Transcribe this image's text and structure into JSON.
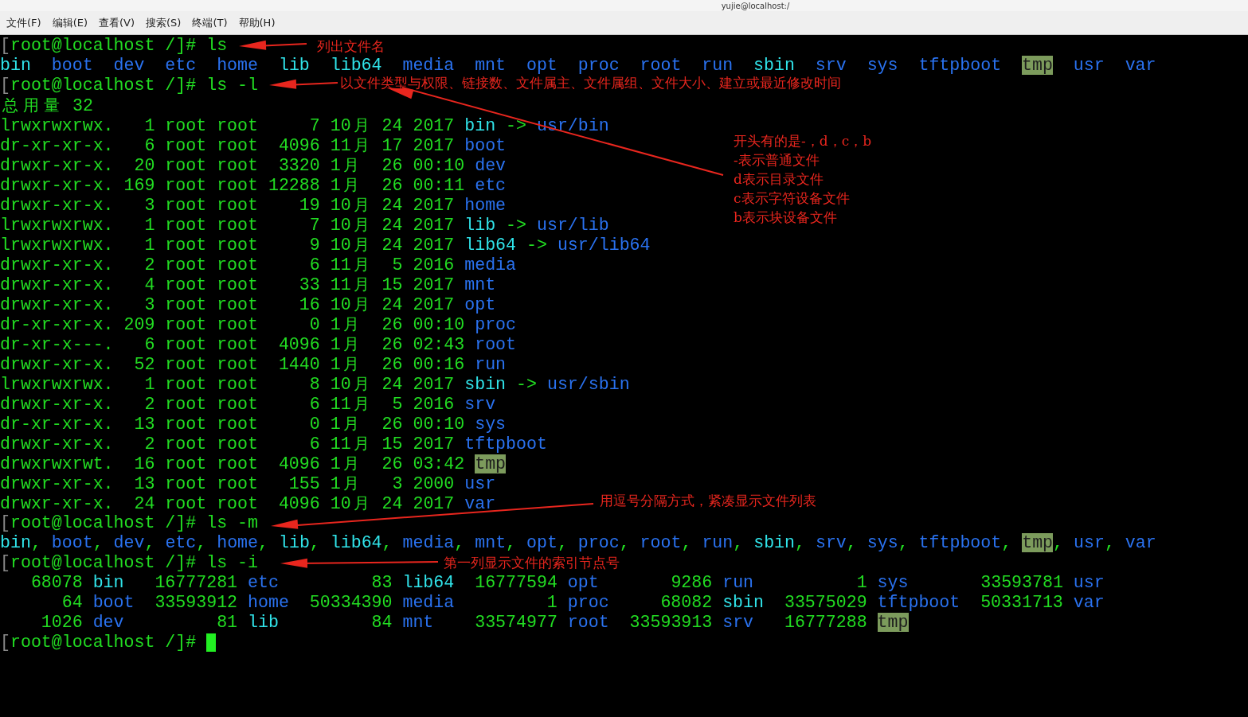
{
  "window": {
    "title": "yujie@localhost:/"
  },
  "menu": [
    "文件(F)",
    "编辑(E)",
    "查看(V)",
    "搜索(S)",
    "终端(T)",
    "帮助(H)"
  ],
  "terminal": {
    "lines": [
      {
        "segments": [
          {
            "text": "[",
            "kind": "bracket"
          },
          {
            "text": "root@localhost /]# ls",
            "kind": "plain"
          }
        ]
      },
      {
        "segments": [
          {
            "text": "bin  ",
            "kind": "link"
          },
          {
            "text": "boot  ",
            "kind": "dir"
          },
          {
            "text": "dev  ",
            "kind": "dir"
          },
          {
            "text": "etc  ",
            "kind": "dir"
          },
          {
            "text": "home  ",
            "kind": "dir"
          },
          {
            "text": "lib  ",
            "kind": "link"
          },
          {
            "text": "lib64  ",
            "kind": "link"
          },
          {
            "text": "media  ",
            "kind": "dir"
          },
          {
            "text": "mnt  ",
            "kind": "dir"
          },
          {
            "text": "opt  ",
            "kind": "dir"
          },
          {
            "text": "proc  ",
            "kind": "dir"
          },
          {
            "text": "root  ",
            "kind": "dir"
          },
          {
            "text": "run  ",
            "kind": "dir"
          },
          {
            "text": "sbin  ",
            "kind": "link"
          },
          {
            "text": "srv  ",
            "kind": "dir"
          },
          {
            "text": "sys  ",
            "kind": "dir"
          },
          {
            "text": "tftpboot  ",
            "kind": "dir"
          },
          {
            "text": "tmp",
            "kind": "sticky"
          },
          {
            "text": "  usr  ",
            "kind": "dir"
          },
          {
            "text": "var",
            "kind": "dir"
          }
        ]
      },
      {
        "segments": [
          {
            "text": "[",
            "kind": "bracket"
          },
          {
            "text": "root@localhost /]# ls -l",
            "kind": "plain"
          }
        ]
      },
      {
        "segments": [
          {
            "text": "总用量 32",
            "kind": "plain"
          }
        ]
      },
      {
        "segments": [
          {
            "text": "lrwxrwxrwx.   1 root root     7 10月 24 2017 ",
            "kind": "plain"
          },
          {
            "text": "bin",
            "kind": "link"
          },
          {
            "text": " -> ",
            "kind": "plain"
          },
          {
            "text": "usr/bin",
            "kind": "dir"
          }
        ]
      },
      {
        "segments": [
          {
            "text": "dr-xr-xr-x.   6 root root  4096 11月 17 2017 ",
            "kind": "plain"
          },
          {
            "text": "boot",
            "kind": "dir"
          }
        ]
      },
      {
        "segments": [
          {
            "text": "drwxr-xr-x.  20 root root  3320 1月  26 00:10 ",
            "kind": "plain"
          },
          {
            "text": "dev",
            "kind": "dir"
          }
        ]
      },
      {
        "segments": [
          {
            "text": "drwxr-xr-x. 169 root root 12288 1月  26 00:11 ",
            "kind": "plain"
          },
          {
            "text": "etc",
            "kind": "dir"
          }
        ]
      },
      {
        "segments": [
          {
            "text": "drwxr-xr-x.   3 root root    19 10月 24 2017 ",
            "kind": "plain"
          },
          {
            "text": "home",
            "kind": "dir"
          }
        ]
      },
      {
        "segments": [
          {
            "text": "lrwxrwxrwx.   1 root root     7 10月 24 2017 ",
            "kind": "plain"
          },
          {
            "text": "lib",
            "kind": "link"
          },
          {
            "text": " -> ",
            "kind": "plain"
          },
          {
            "text": "usr/lib",
            "kind": "dir"
          }
        ]
      },
      {
        "segments": [
          {
            "text": "lrwxrwxrwx.   1 root root     9 10月 24 2017 ",
            "kind": "plain"
          },
          {
            "text": "lib64",
            "kind": "link"
          },
          {
            "text": " -> ",
            "kind": "plain"
          },
          {
            "text": "usr/lib64",
            "kind": "dir"
          }
        ]
      },
      {
        "segments": [
          {
            "text": "drwxr-xr-x.   2 root root     6 11月  5 2016 ",
            "kind": "plain"
          },
          {
            "text": "media",
            "kind": "dir"
          }
        ]
      },
      {
        "segments": [
          {
            "text": "drwxr-xr-x.   4 root root    33 11月 15 2017 ",
            "kind": "plain"
          },
          {
            "text": "mnt",
            "kind": "dir"
          }
        ]
      },
      {
        "segments": [
          {
            "text": "drwxr-xr-x.   3 root root    16 10月 24 2017 ",
            "kind": "plain"
          },
          {
            "text": "opt",
            "kind": "dir"
          }
        ]
      },
      {
        "segments": [
          {
            "text": "dr-xr-xr-x. 209 root root     0 1月  26 00:10 ",
            "kind": "plain"
          },
          {
            "text": "proc",
            "kind": "dir"
          }
        ]
      },
      {
        "segments": [
          {
            "text": "dr-xr-x---.   6 root root  4096 1月  26 02:43 ",
            "kind": "plain"
          },
          {
            "text": "root",
            "kind": "dir"
          }
        ]
      },
      {
        "segments": [
          {
            "text": "drwxr-xr-x.  52 root root  1440 1月  26 00:16 ",
            "kind": "plain"
          },
          {
            "text": "run",
            "kind": "dir"
          }
        ]
      },
      {
        "segments": [
          {
            "text": "lrwxrwxrwx.   1 root root     8 10月 24 2017 ",
            "kind": "plain"
          },
          {
            "text": "sbin",
            "kind": "link"
          },
          {
            "text": " -> ",
            "kind": "plain"
          },
          {
            "text": "usr/sbin",
            "kind": "dir"
          }
        ]
      },
      {
        "segments": [
          {
            "text": "drwxr-xr-x.   2 root root     6 11月  5 2016 ",
            "kind": "plain"
          },
          {
            "text": "srv",
            "kind": "dir"
          }
        ]
      },
      {
        "segments": [
          {
            "text": "dr-xr-xr-x.  13 root root     0 1月  26 00:10 ",
            "kind": "plain"
          },
          {
            "text": "sys",
            "kind": "dir"
          }
        ]
      },
      {
        "segments": [
          {
            "text": "drwxr-xr-x.   2 root root     6 11月 15 2017 ",
            "kind": "plain"
          },
          {
            "text": "tftpboot",
            "kind": "dir"
          }
        ]
      },
      {
        "segments": [
          {
            "text": "drwxrwxrwt.  16 root root  4096 1月  26 03:42 ",
            "kind": "plain"
          },
          {
            "text": "tmp",
            "kind": "sticky"
          }
        ]
      },
      {
        "segments": [
          {
            "text": "drwxr-xr-x.  13 root root   155 1月   3 2000 ",
            "kind": "plain"
          },
          {
            "text": "usr",
            "kind": "dir"
          }
        ]
      },
      {
        "segments": [
          {
            "text": "drwxr-xr-x.  24 root root  4096 10月 24 2017 ",
            "kind": "plain"
          },
          {
            "text": "var",
            "kind": "dir"
          }
        ]
      },
      {
        "segments": [
          {
            "text": "[",
            "kind": "bracket"
          },
          {
            "text": "root@localhost /]# ls -m",
            "kind": "plain"
          }
        ]
      },
      {
        "segments": [
          {
            "text": "bin",
            "kind": "link"
          },
          {
            "text": ", ",
            "kind": "plain"
          },
          {
            "text": "boot",
            "kind": "dir"
          },
          {
            "text": ", ",
            "kind": "plain"
          },
          {
            "text": "dev",
            "kind": "dir"
          },
          {
            "text": ", ",
            "kind": "plain"
          },
          {
            "text": "etc",
            "kind": "dir"
          },
          {
            "text": ", ",
            "kind": "plain"
          },
          {
            "text": "home",
            "kind": "dir"
          },
          {
            "text": ", ",
            "kind": "plain"
          },
          {
            "text": "lib",
            "kind": "link"
          },
          {
            "text": ", ",
            "kind": "plain"
          },
          {
            "text": "lib64",
            "kind": "link"
          },
          {
            "text": ", ",
            "kind": "plain"
          },
          {
            "text": "media",
            "kind": "dir"
          },
          {
            "text": ", ",
            "kind": "plain"
          },
          {
            "text": "mnt",
            "kind": "dir"
          },
          {
            "text": ", ",
            "kind": "plain"
          },
          {
            "text": "opt",
            "kind": "dir"
          },
          {
            "text": ", ",
            "kind": "plain"
          },
          {
            "text": "proc",
            "kind": "dir"
          },
          {
            "text": ", ",
            "kind": "plain"
          },
          {
            "text": "root",
            "kind": "dir"
          },
          {
            "text": ", ",
            "kind": "plain"
          },
          {
            "text": "run",
            "kind": "dir"
          },
          {
            "text": ", ",
            "kind": "plain"
          },
          {
            "text": "sbin",
            "kind": "link"
          },
          {
            "text": ", ",
            "kind": "plain"
          },
          {
            "text": "srv",
            "kind": "dir"
          },
          {
            "text": ", ",
            "kind": "plain"
          },
          {
            "text": "sys",
            "kind": "dir"
          },
          {
            "text": ", ",
            "kind": "plain"
          },
          {
            "text": "tftpboot",
            "kind": "dir"
          },
          {
            "text": ", ",
            "kind": "plain"
          },
          {
            "text": "tmp",
            "kind": "sticky"
          },
          {
            "text": ", ",
            "kind": "plain"
          },
          {
            "text": "usr",
            "kind": "dir"
          },
          {
            "text": ", ",
            "kind": "plain"
          },
          {
            "text": "var",
            "kind": "dir"
          }
        ]
      },
      {
        "segments": [
          {
            "text": "[",
            "kind": "bracket"
          },
          {
            "text": "root@localhost /]# ls -i",
            "kind": "plain"
          }
        ]
      },
      {
        "segments": [
          {
            "text": "   68078 ",
            "kind": "plain"
          },
          {
            "text": "bin",
            "kind": "link"
          },
          {
            "text": "   16777281 ",
            "kind": "plain"
          },
          {
            "text": "etc",
            "kind": "dir"
          },
          {
            "text": "         83 ",
            "kind": "plain"
          },
          {
            "text": "lib64",
            "kind": "link"
          },
          {
            "text": "  16777594 ",
            "kind": "plain"
          },
          {
            "text": "opt",
            "kind": "dir"
          },
          {
            "text": "       9286 ",
            "kind": "plain"
          },
          {
            "text": "run",
            "kind": "dir"
          },
          {
            "text": "          1 ",
            "kind": "plain"
          },
          {
            "text": "sys",
            "kind": "dir"
          },
          {
            "text": "       33593781 ",
            "kind": "plain"
          },
          {
            "text": "usr",
            "kind": "dir"
          }
        ]
      },
      {
        "segments": [
          {
            "text": "      64 ",
            "kind": "plain"
          },
          {
            "text": "boot",
            "kind": "dir"
          },
          {
            "text": "  33593912 ",
            "kind": "plain"
          },
          {
            "text": "home",
            "kind": "dir"
          },
          {
            "text": "  50334390 ",
            "kind": "plain"
          },
          {
            "text": "media",
            "kind": "dir"
          },
          {
            "text": "         1 ",
            "kind": "plain"
          },
          {
            "text": "proc",
            "kind": "dir"
          },
          {
            "text": "     68082 ",
            "kind": "plain"
          },
          {
            "text": "sbin",
            "kind": "link"
          },
          {
            "text": "  33575029 ",
            "kind": "plain"
          },
          {
            "text": "tftpboot",
            "kind": "dir"
          },
          {
            "text": "  50331713 ",
            "kind": "plain"
          },
          {
            "text": "var",
            "kind": "dir"
          }
        ]
      },
      {
        "segments": [
          {
            "text": "    1026 ",
            "kind": "plain"
          },
          {
            "text": "dev",
            "kind": "dir"
          },
          {
            "text": "         81 ",
            "kind": "plain"
          },
          {
            "text": "lib",
            "kind": "link"
          },
          {
            "text": "         84 ",
            "kind": "plain"
          },
          {
            "text": "mnt",
            "kind": "dir"
          },
          {
            "text": "    33574977 ",
            "kind": "plain"
          },
          {
            "text": "root",
            "kind": "dir"
          },
          {
            "text": "  33593913 ",
            "kind": "plain"
          },
          {
            "text": "srv",
            "kind": "dir"
          },
          {
            "text": "   16777288 ",
            "kind": "plain"
          },
          {
            "text": "tmp",
            "kind": "sticky"
          }
        ]
      },
      {
        "segments": [
          {
            "text": "[",
            "kind": "bracket"
          },
          {
            "text": "root@localhost /]# ",
            "kind": "plain"
          }
        ],
        "cursor": true
      }
    ]
  },
  "annotations": [
    {
      "lines": [
        "列出文件名"
      ]
    },
    {
      "lines": [
        "以文件类型与权限、链接数、文件属主、文件属组、文件大小、建立或最近修改时间"
      ]
    },
    {
      "lines": [
        "开头有的是-，d，c，b",
        "-表示普通文件",
        "d表示目录文件",
        "c表示字符设备文件",
        "b表示块设备文件"
      ]
    },
    {
      "lines": [
        "用逗号分隔方式，紧凑显示文件列表"
      ]
    },
    {
      "lines": [
        "第一列显示文件的索引节点号"
      ]
    }
  ]
}
